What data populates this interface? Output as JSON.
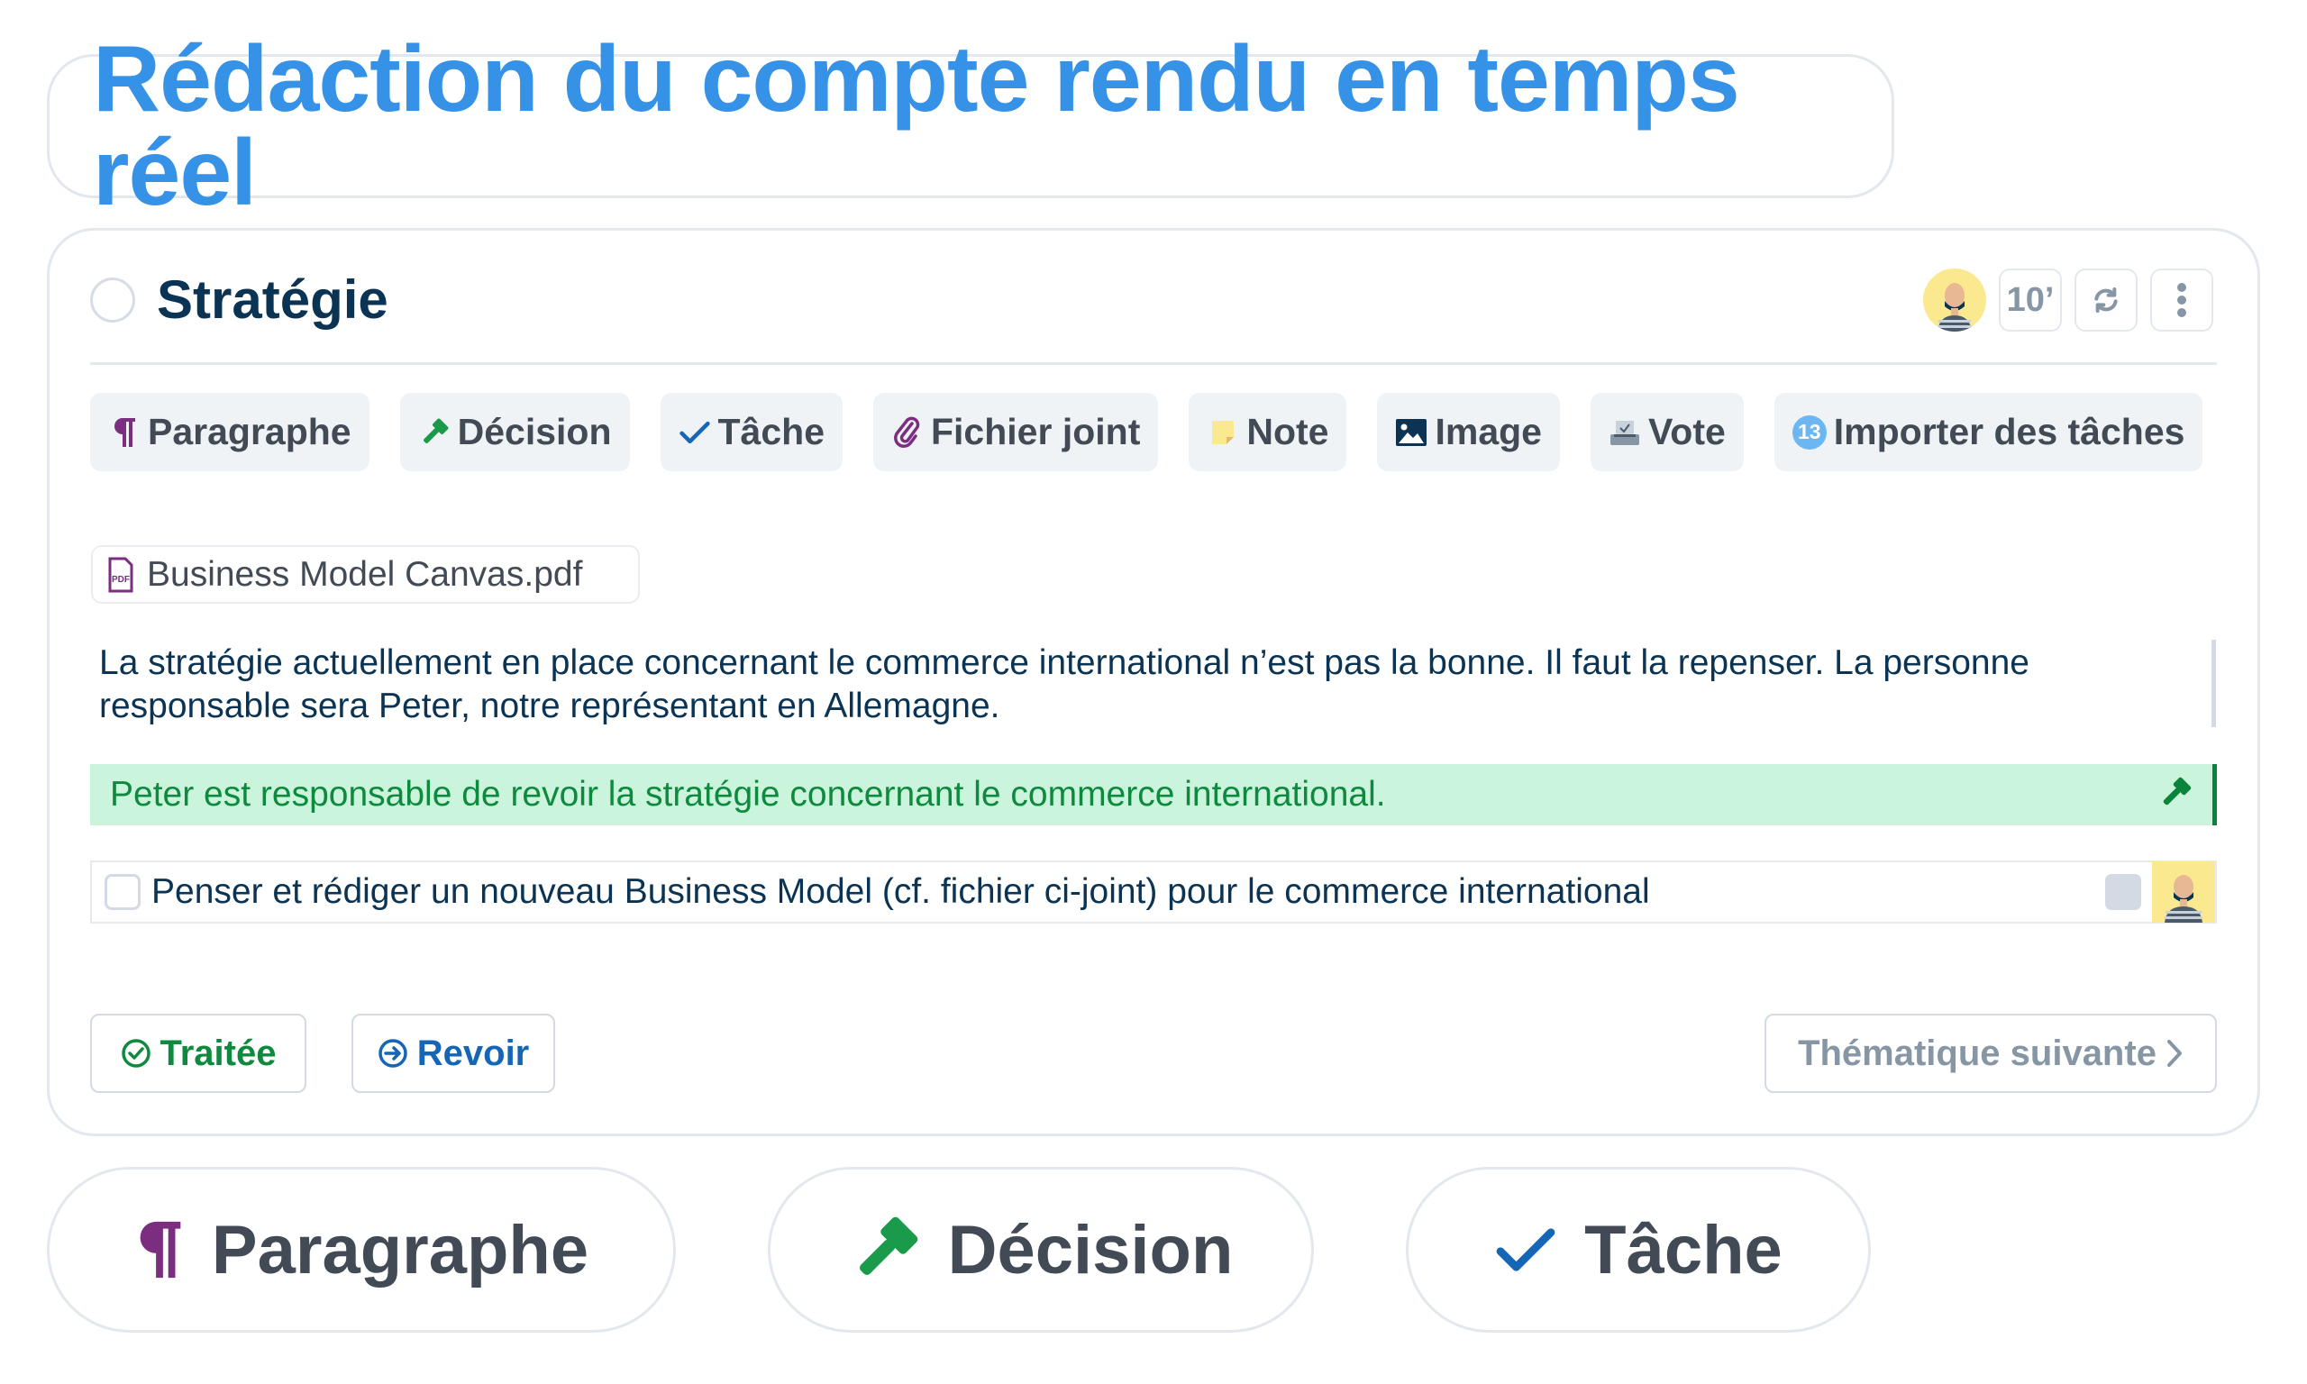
{
  "header": {
    "title": "Rédaction du compte rendu en temps réel"
  },
  "topic": {
    "title": "Stratégie",
    "duration": "10’",
    "icons": {
      "status": "radio-circle-icon",
      "assignee": "avatar-icon",
      "refresh": "refresh-icon",
      "more": "more-vertical-icon"
    }
  },
  "toolbar": {
    "items": [
      {
        "label": "Paragraphe",
        "icon": "paragraph-icon",
        "color": "#7b2d7f"
      },
      {
        "label": "Décision",
        "icon": "gavel-icon",
        "color": "#1a9a4b"
      },
      {
        "label": "Tâche",
        "icon": "check-icon",
        "color": "#1566b7"
      },
      {
        "label": "Fichier joint",
        "icon": "paperclip-icon",
        "color": "#7b2d7f"
      },
      {
        "label": "Note",
        "icon": "sticky-note-icon",
        "color": "#fbe98f"
      },
      {
        "label": "Image",
        "icon": "image-icon",
        "color": "#0b3353"
      },
      {
        "label": "Vote",
        "icon": "ballot-box-icon",
        "color": "#8796a5"
      },
      {
        "label": "Importer des tâches",
        "icon": "import-badge-icon",
        "badge": "13",
        "color": "#6cb7f2"
      }
    ]
  },
  "content": {
    "attachment": {
      "filename": "Business Model Canvas.pdf",
      "icon_text": "PDF"
    },
    "paragraph": "La stratégie actuellement en place concernant le commerce international n’est pas la bonne. Il faut la repenser. La personne responsable sera Peter, notre représentant en Allemagne.",
    "decision": "Peter est responsable de revoir la stratégie concernant le commerce international.",
    "task": {
      "text": "Penser et rédiger un nouveau Business Model (cf. fichier ci-joint) pour le commerce international",
      "checked": false
    }
  },
  "footer": {
    "done_label": "Traitée",
    "review_label": "Revoir",
    "next_label": "Thématique suivante"
  },
  "pills": [
    {
      "label": "Paragraphe",
      "icon": "paragraph-icon"
    },
    {
      "label": "Décision",
      "icon": "gavel-icon"
    },
    {
      "label": "Tâche",
      "icon": "check-icon"
    }
  ],
  "colors": {
    "title_blue": "#3592e6",
    "navy": "#0b3353",
    "decision_bg": "#cbf4dc",
    "decision_text": "#0e8a3e",
    "task_blue": "#1566b7",
    "muted": "#8796a5"
  }
}
